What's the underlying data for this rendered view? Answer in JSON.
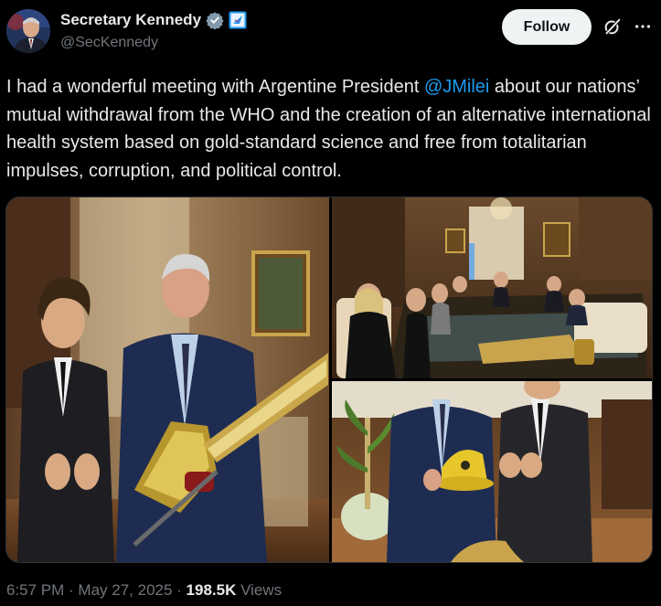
{
  "author": {
    "name": "Secretary Kennedy",
    "handle": "@SecKennedy",
    "verified_badge_color": "#829aab",
    "affiliation_badge_color": "#1d9bf0"
  },
  "actions": {
    "follow_label": "Follow",
    "grok_icon": "grok-icon",
    "more_icon": "more-icon"
  },
  "tweet": {
    "text_before": "I had a wonderful meeting with Argentine President ",
    "mention": "@JMilei",
    "text_after": " about our nations’ mutual withdrawal from the WHO and the creation of an alternative international health system based on gold-standard science and free from totalitarian impulses, corruption, and political control."
  },
  "media": {
    "count": 3
  },
  "footer": {
    "time": "6:57 PM",
    "sep1": " · ",
    "date": "May 27, 2025",
    "sep2": " · ",
    "views_count": "198.5K",
    "views_label": " Views"
  },
  "colors": {
    "background": "#000000",
    "text": "#e7e9ea",
    "secondary": "#71767b",
    "link": "#1d9bf0",
    "follow_bg": "#eff3f4"
  }
}
